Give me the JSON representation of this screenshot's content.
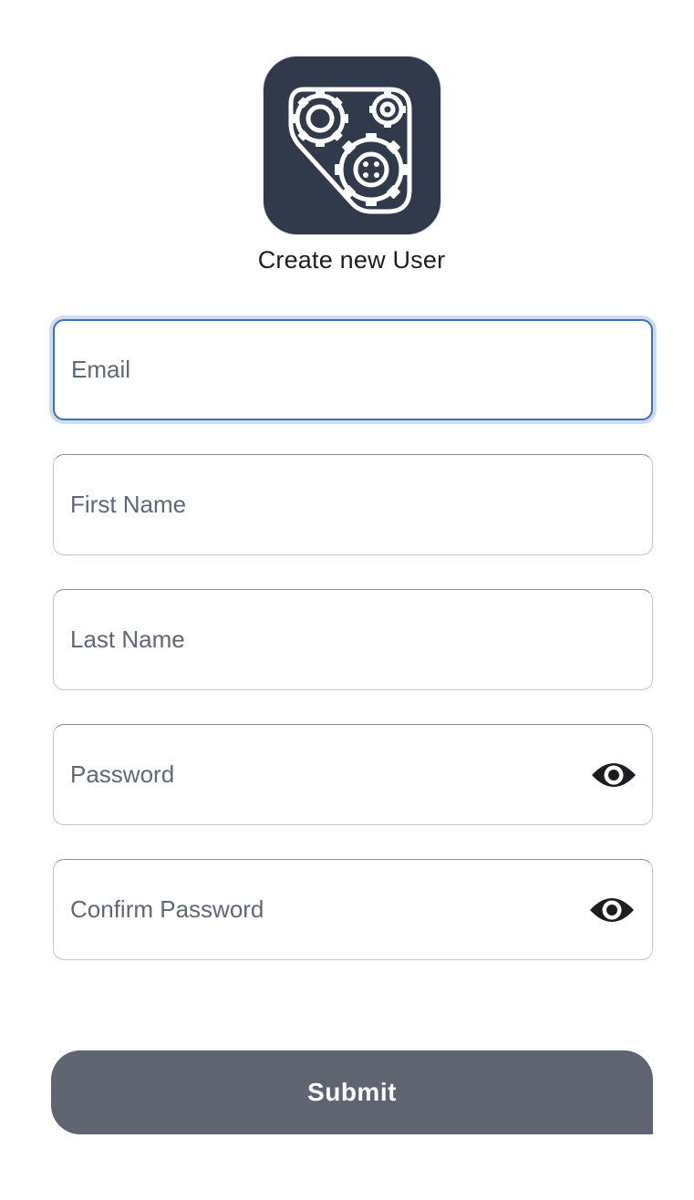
{
  "app": {
    "logo_icon": "gears-icon",
    "title": "Create new User"
  },
  "form": {
    "email": {
      "placeholder": "Email",
      "value": ""
    },
    "first_name": {
      "placeholder": "First Name",
      "value": ""
    },
    "last_name": {
      "placeholder": "Last Name",
      "value": ""
    },
    "password": {
      "placeholder": "Password",
      "value": "",
      "toggle_icon": "eye-icon"
    },
    "confirm_password": {
      "placeholder": "Confirm Password",
      "value": "",
      "toggle_icon": "eye-icon"
    },
    "submit_label": "Submit"
  },
  "colors": {
    "logo_background": "#303a4b",
    "focus_border": "#3c6fbe",
    "submit_background": "#5f6570",
    "placeholder_text": "#5e6877"
  }
}
